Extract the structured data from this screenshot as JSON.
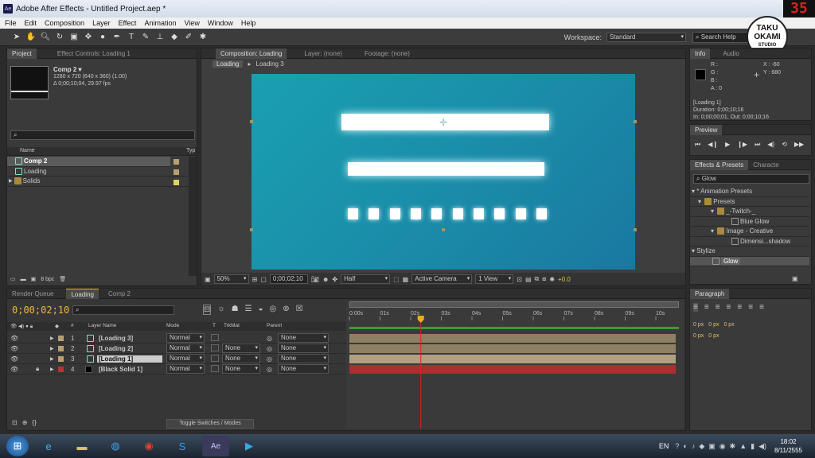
{
  "window": {
    "title": "Adobe After Effects - Untitled Project.aep *",
    "corner_number": "35"
  },
  "menu": [
    "File",
    "Edit",
    "Composition",
    "Layer",
    "Effect",
    "Animation",
    "View",
    "Window",
    "Help"
  ],
  "toolbar": {
    "workspace_label": "Workspace:",
    "workspace_value": "Standard",
    "search_help": "Search Help"
  },
  "watermark": {
    "line1": "TAKU",
    "line2": "OKAMI",
    "line3": "STUDIO"
  },
  "project": {
    "tabs": [
      "Project",
      "Effect Controls: Loading 1"
    ],
    "comp_name": "Comp 2 ▾",
    "comp_info1": "1280 x 720  (640 x 360) (1.00)",
    "comp_info2": "Δ 0;00;10;04, 29.97 fps",
    "col_name": "Name",
    "col_type": "Typ",
    "items": [
      {
        "name": "Comp 2",
        "swatch": "#b8a070"
      },
      {
        "name": "Loading",
        "swatch": "#b8a070"
      },
      {
        "name": "Solids",
        "swatch": "#e0d060"
      }
    ],
    "bpc": "8 bpc"
  },
  "composition": {
    "tabs": [
      "Composition: Loading",
      "Layer: (none)",
      "Footage: (none)"
    ],
    "crumbs": [
      "Loading",
      "Loading 3"
    ],
    "zoom": "50%",
    "timecode": "0;00;02;10",
    "resolution": "Half",
    "camera": "Active Camera",
    "view": "1 View",
    "offset": "+0.0",
    "canvas_color": "#1a92a8"
  },
  "info": {
    "tabs": [
      "Info",
      "Audio"
    ],
    "r": "R :",
    "g": "G :",
    "b": "B :",
    "a": "A : 0",
    "x": "X : -60",
    "y": "Y : 680",
    "layer": "[Loading 1]",
    "duration": "Duration: 0;00;10;16",
    "inout": "In: 0;00;00;01, Out: 0;00;10;16"
  },
  "preview": {
    "title": "Preview"
  },
  "effects": {
    "tabs": [
      "Effects & Presets",
      "Characte"
    ],
    "search": "Glow",
    "tree": [
      {
        "label": "* Animation Presets",
        "indent": 0
      },
      {
        "label": "Presets",
        "indent": 1
      },
      {
        "label": "_-Twitch-_",
        "indent": 2
      },
      {
        "label": "Blue Glow",
        "indent": 3
      },
      {
        "label": "Image - Creative",
        "indent": 2
      },
      {
        "label": "Dimensi...shadow",
        "indent": 3
      },
      {
        "label": "Stylize",
        "indent": 0
      },
      {
        "label": "Glow",
        "indent": 1
      }
    ]
  },
  "paragraph": {
    "title": "Paragraph",
    "px1": "0 px",
    "px2": "0 px",
    "px3": "0 px",
    "px4": "0 px",
    "px5": "0 px"
  },
  "timeline": {
    "tabs": [
      "Render Queue",
      "Loading",
      "Comp 2"
    ],
    "timecode": "0;00;02;10",
    "headers": {
      "layer_name": "Layer Name",
      "mode": "Mode",
      "t": "T",
      "trkmat": "TrkMat",
      "parent": "Parent"
    },
    "layers": [
      {
        "num": "1",
        "name": "[Loading 3]",
        "mode": "Normal",
        "trkmat": "",
        "parent": "None",
        "color": "#b8a070"
      },
      {
        "num": "2",
        "name": "[Loading 2]",
        "mode": "Normal",
        "trkmat": "None",
        "parent": "None",
        "color": "#b8a070"
      },
      {
        "num": "3",
        "name": "[Loading 1]",
        "mode": "Normal",
        "trkmat": "None",
        "parent": "None",
        "color": "#b8a070"
      },
      {
        "num": "4",
        "name": "[Black Solid 1]",
        "mode": "Normal",
        "trkmat": "None",
        "parent": "None",
        "color": "#c03030"
      }
    ],
    "ruler": [
      "0:00s",
      "01s",
      "02s",
      "03s",
      "04s",
      "05s",
      "06s",
      "07s",
      "08s",
      "09s",
      "10s"
    ],
    "toggle": "Toggle Switches / Modes",
    "playhead_seconds": 2.33
  },
  "taskbar": {
    "lang": "EN",
    "time": "18:02",
    "date": "8/11/2555"
  }
}
